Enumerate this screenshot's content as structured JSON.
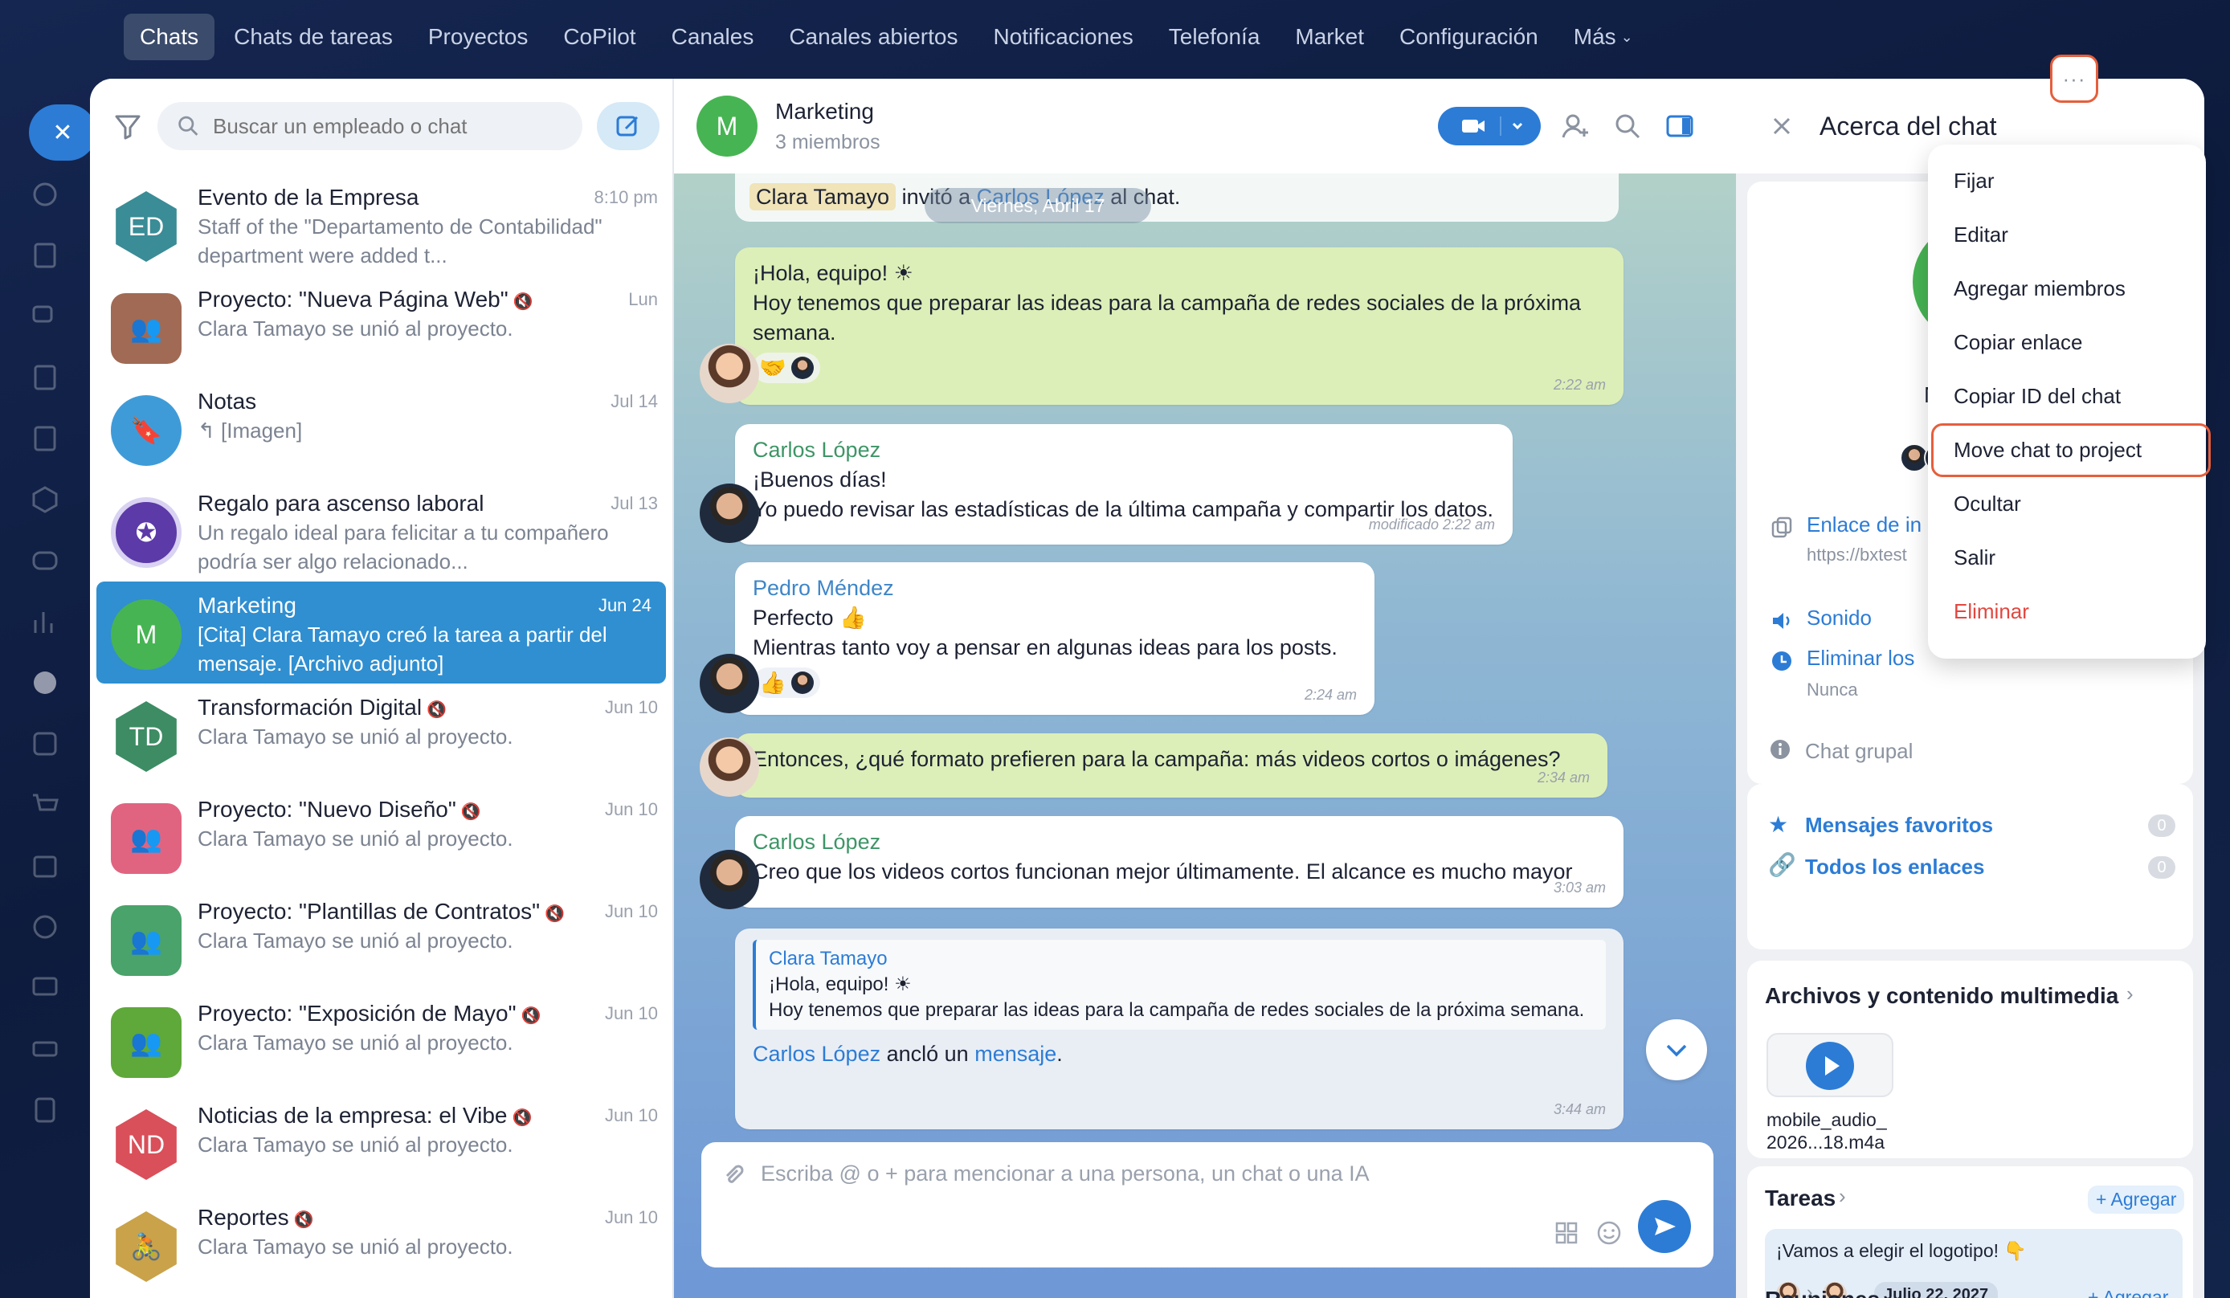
{
  "topnav": {
    "items": [
      "Chats",
      "Chats de tareas",
      "Proyectos",
      "CoPilot",
      "Canales",
      "Canales abiertos",
      "Notificaciones",
      "Telefonía",
      "Market",
      "Configuración",
      "Más"
    ]
  },
  "chatlist": {
    "search_placeholder": "Buscar un empleado o chat",
    "items": [
      {
        "avatar": "ED",
        "name": "Evento de la Empresa",
        "date": "8:10 pm",
        "msg": "Staff of the \"Departamento de Contabilidad\" department were added t...",
        "color": "#3a8c96"
      },
      {
        "avatar": "",
        "name": "Proyecto: \"Nueva Página Web\"",
        "date": "Lun",
        "msg": "Clara Tamayo se unió al proyecto.",
        "color": "#a06a55"
      },
      {
        "avatar": "",
        "name": "Notas",
        "date": "Jul 14",
        "msg": "↰ [Imagen]",
        "color": "#3f9bd8"
      },
      {
        "avatar": "",
        "name": "Regalo para ascenso laboral",
        "date": "Jul 13",
        "msg": "Un regalo ideal para felicitar a tu compañero podría ser algo relacionado...",
        "color": "#5c3aa8"
      },
      {
        "avatar": "M",
        "name": "Marketing",
        "date": "Jun 24",
        "msg": "[Cita] Clara Tamayo creó la tarea a partir del mensaje. [Archivo adjunto]",
        "color": "#47b453"
      },
      {
        "avatar": "TD",
        "name": "Transformación Digital",
        "date": "Jun 10",
        "msg": "Clara Tamayo se unió al proyecto.",
        "color": "#3d8c64"
      },
      {
        "avatar": "",
        "name": "Proyecto: \"Nuevo Diseño\"",
        "date": "Jun 10",
        "msg": "Clara Tamayo se unió al proyecto.",
        "color": "#e06480"
      },
      {
        "avatar": "",
        "name": "Proyecto: \"Plantillas de Contratos\"",
        "date": "Jun 10",
        "msg": "Clara Tamayo se unió al proyecto.",
        "color": "#4aa36a"
      },
      {
        "avatar": "",
        "name": "Proyecto: \"Exposición de Mayo\"",
        "date": "Jun 10",
        "msg": "Clara Tamayo se unió al proyecto.",
        "color": "#5fa83a"
      },
      {
        "avatar": "ND",
        "name": "Noticias de la empresa: el Vibe",
        "date": "Jun 10",
        "msg": "Clara Tamayo se unió al proyecto.",
        "color": "#d94f5a"
      },
      {
        "avatar": "",
        "name": "Reportes",
        "date": "Jun 10",
        "msg": "Clara Tamayo se unió al proyecto.",
        "color": "#c9a24a"
      }
    ]
  },
  "conversation": {
    "title": "Marketing",
    "subtitle": "3 miembros",
    "system_name": "Clara Tamayo",
    "system_text1": "invitó a",
    "system_link": "Carlos López",
    "system_text2": "al chat.",
    "date_pill": "Viernes, Abril 17",
    "m1_line1": "¡Hola, equipo! ☀",
    "m1_line2": "Hoy tenemos que preparar las ideas para la campaña de redes sociales de la próxima semana.",
    "m1_time": "2:22 am",
    "m2_author": "Carlos López",
    "m2_line1": "¡Buenos días!",
    "m2_line2": "Yo puedo revisar las estadísticas de la última campaña y compartir los datos.",
    "m2_time": "modificado 2:22 am",
    "m3_author": "Pedro Méndez",
    "m3_line1": "Perfecto 👍",
    "m3_line2": "Mientras tanto voy a pensar en algunas ideas para los posts.",
    "m3_time": "2:24 am",
    "m4_text": "Entonces, ¿qué formato prefieren para la campaña: más videos cortos o imágenes?",
    "m4_time": "2:34 am",
    "m5_author": "Carlos López",
    "m5_text": "Creo que los videos cortos funcionan mejor últimamente. El alcance es mucho mayor",
    "m5_time": "3:03 am",
    "q_author": "Clara Tamayo",
    "q_line1": "¡Hola, equipo! ☀",
    "q_line2": "Hoy tenemos que preparar las ideas para la campaña de redes sociales de la próxima semana.",
    "pin_user": "Carlos López",
    "pin_text": "ancló un",
    "pin_link": "mensaje",
    "pin_dot": ".",
    "pin_time": "3:44 am",
    "input_placeholder": "Escriba @ o + para mencionar a una persona, un chat o una IA"
  },
  "sidepanel": {
    "title": "Acerca del chat",
    "more_label": "···",
    "name_partial": "M",
    "invite_label": "Enlace de in",
    "invite_url": "https://bxtest",
    "sound_label": "Sonido",
    "delete_label": "Eliminar los",
    "delete_value": "Nunca",
    "chat_type": "Chat grupal",
    "favorites_label": "Mensajes favoritos",
    "favorites_count": "0",
    "links_label": "Todos los enlaces",
    "links_count": "0",
    "files_title": "Archivos y contenido multimedia",
    "file_name1": "mobile_audio_",
    "file_name2": "2026...18.m4a",
    "tasks_title": "Tareas",
    "tasks_add": "+ Agregar",
    "task_title": "¡Vamos a elegir el logotipo! 👇",
    "task_date": "Julio 22, 2027",
    "meetings_title": "Reuniones",
    "meetings_add": "+ Agregar"
  },
  "menu": {
    "items": [
      "Fijar",
      "Editar",
      "Agregar miembros",
      "Copiar enlace",
      "Copiar ID del chat",
      "Move chat to project",
      "Ocultar",
      "Salir",
      "Eliminar"
    ]
  },
  "colors": {
    "accent": "#2c7cd6",
    "highlight": "#e65f3c",
    "selected": "#2f8fd1",
    "danger": "#e2473f"
  }
}
